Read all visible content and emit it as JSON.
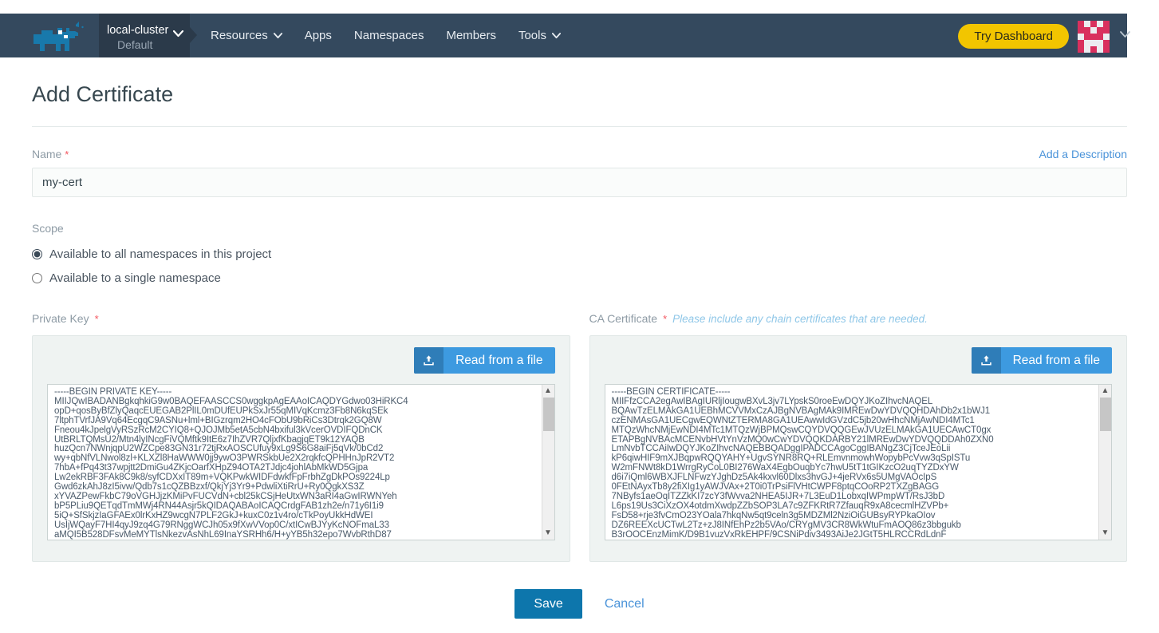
{
  "header": {
    "logo_icon": "rancher-rhino-logo",
    "cluster": {
      "name": "local-cluster",
      "project": "Default",
      "chevron": "⌄"
    },
    "nav": [
      {
        "label": "Resources",
        "has_menu": true
      },
      {
        "label": "Apps",
        "has_menu": false
      },
      {
        "label": "Namespaces",
        "has_menu": false
      },
      {
        "label": "Members",
        "has_menu": false
      },
      {
        "label": "Tools",
        "has_menu": true
      }
    ],
    "try_dashboard_label": "Try Dashboard",
    "avatar_icon": "user-identicon-avatar",
    "avatar_chevron": "⌄",
    "colors": {
      "navbar": "#34495e",
      "cluster_box": "#2b3a4a",
      "try_dashboard": "#f2c500",
      "avatar_primary": "#d9305e",
      "avatar_secondary": "#ececf0"
    }
  },
  "page": {
    "title": "Add Certificate"
  },
  "name_field": {
    "label": "Name",
    "required_mark": "*",
    "add_description_link": "Add a Description",
    "value": "my-cert",
    "placeholder": ""
  },
  "scope": {
    "label": "Scope",
    "options": [
      {
        "label": "Available to all namespaces in this project",
        "selected": true
      },
      {
        "label": "Available to a single namespace",
        "selected": false
      }
    ]
  },
  "private_key": {
    "label": "Private Key",
    "required_mark": "*",
    "read_file_label": "Read from a file",
    "upload_icon": "upload-icon",
    "value": "-----BEGIN PRIVATE KEY-----\nMIIJQwIBADANBgkqhkiG9w0BAQEFAASCCS0wggkpAgEAAoICAQDYGdwo03HiRKC4\nopD+qosByBfZlyQaqcEUEGAB2PlIL0mDUfEUPkSxJr55qMIVqKcmz3Fb8N6kqSEk\n7ltphTVrfJA9Vq64EcgqC9ASNu+lml+BIGzrqm2HO4cFObU9bRiCs3Dtrqk2GQ8W\nFneou4kJpelgVyRSzRcM2CYIQ8+QJOJMb5etA5cbN4bxiful3kVcerOVDIFQDnCK\nUtBRLTQMsU2/Mtn4lyINcgFiVQMftk9ItE6z7IhZVR7QljxfKbagjqET9k12YAQB\nhuzQcn7NWnjqpU2WZCpe83GN31r72tjRxAOSCUfuy9xLg9S6G8aiFj5qVk/0bCd2\nwy+qbNfVLNwol8zl+KLXZl8HaWWW0jj9ywO3PWRSkbUe2X2rqkfcQPHHnJpR2VT2\n7hbA+fPq43t37wpjtt2DmiGu4ZKjcOarfXHpZ94OTA2TJdjc4johlAbMkWD5Gjpa\nLw2ekRBF3FAk8C9k8/syfCDXxIT89m+VQKPwkWIDFdwkfFpFrbhZgDkPOs9224Lp\nGwd6zkAhJ8zI5ivw/Qdb7s1cQZBBzxf/QkjYj3Yr9+PdwliXtiRrU+Ry0QgkXS3Z\nxYVAZPewFkbC79oVGHJjzKMiPvFUCVdN+cbl25kCSjHeUtxWN3aRI4aGwIRWNYeh\nbP5PLiu9QETqdTmMWj4RN44Asjr5kQIDAQABAoICAQCrdgFAB1zh2e/n71y6I1i9\n5iQ+SfSkjzIaGFAEx0lrKxHZ9wcgN7PLF2GkJ+kuxC0z1v4ro/cTkPoyUkkHdWEI\nUsIjWQayF7HI4qyJ9zq4G79RNggWCJh05x9fXwVVop0C/xtICwBJYyKcNOFmaL33\naMQI5B528DFsvMeMYTlsNkezvAsNhL69InaYSRHh6/H+yYB5h32epo7WvbRthD87"
  },
  "ca_certificate": {
    "label": "CA Certificate",
    "required_mark": "*",
    "hint": "Please include any chain certificates that are needed.",
    "read_file_label": "Read from a file",
    "upload_icon": "upload-icon",
    "value": "-----BEGIN CERTIFICATE-----\nMIIFfzCCA2egAwIBAgIURljIougwBXvL3jv7LYpskS0roeEwDQYJKoZIhvcNAQEL\nBQAwTzELMAkGA1UEBhMCVVMxCzAJBgNVBAgMAk9IMREwDwYDVQQHDAhDb2x1bWJ1\nczENMAsGA1UECgwEQWNtZTERMA8GA1UEAwwIdGVzdC5jb20wHhcNMjAwNDI4MTc1\nMTQzWhcNMjEwNDI4MTc1MTQzWjBPMQswCQYDVQQGEwJVUzELMAkGA1UECAwCT0gx\nETAPBgNVBAcMCENvbHVtYnVzMQ0wCwYDVQQKDARBY21lMREwDwYDVQQDDAh0ZXN0\nLmNvbTCCAiIwDQYJKoZIhvcNAQEBBQADggIPADCCAgoCggIBANgZ3CjTceJEoLii\nkP6qiwHIF9mXJBqpwRQQYAHY+UgvSYNR8RQ+RLEmvnmowhWopybPcVvw3qSpISTu\nW2mFNWt8kD1WrrgRyCoL0BI276WaX4EgbOuqbYc7hwU5tT1tGIKzcO2uqTYZDxYW\nd6i7iQml6WBXJFLNFwzYJghDz5Ak4kxvl60Dlxs3hvGJ+4jeRVx6s5UMgVAOcIpS\n0FEtNAyxTb8y2fiXIg1yAWJVAx+2T0i0TrPsiFlVHtCWPF8ptqCOoRP2TXZgBAGG\n7NByfs1aeOqITZZkKI7zcY3fWvva2NHEA5IJR+7L3EuD1LobxqIWPmpWT/RsJ3bD\nL6ps19Us3CiXzOX4otdmXwdpZZbSOP3LA7c9ZFKRtR7ZfauqR9xA8cecmlHZVPb+\nFsD58+rje3fvCmO23YOala7hkqNw5qt9celn3g5MDZMl2NziOiGUBsyRYPkaOIov\nDZ6REEXcUCTwL2Tz+zJ8INfEhPz2b5VAo/CRYgMV3CR8WkWtuFmAOQ86z3bbgukb\nB3rOOCEnzMimK/D9B1vuzVxRkEHPF/9CSNiPdiv3493AiJe2JGtT5HLRCCRdLdnF"
  },
  "footer": {
    "save_label": "Save",
    "cancel_label": "Cancel"
  }
}
